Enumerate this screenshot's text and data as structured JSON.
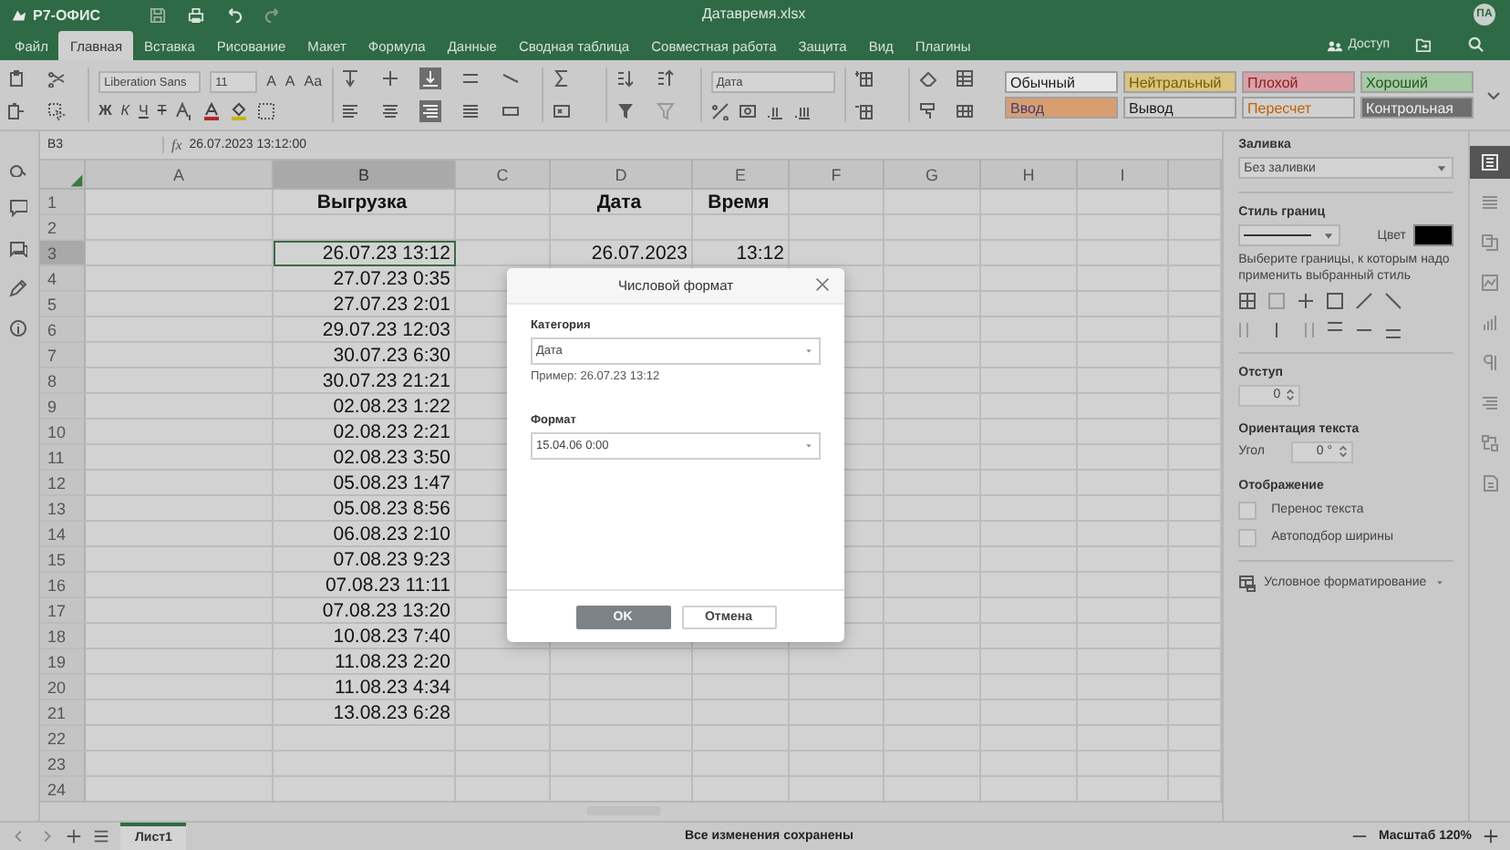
{
  "app": {
    "logo": "Р7-ОФИС",
    "file_name": "Датавремя.xlsx",
    "avatar": "ПА"
  },
  "menu_tabs": [
    {
      "label": "Файл",
      "selected": false
    },
    {
      "label": "Главная",
      "selected": true
    },
    {
      "label": "Вставка",
      "selected": false
    },
    {
      "label": "Рисование",
      "selected": false
    },
    {
      "label": "Макет",
      "selected": false
    },
    {
      "label": "Формула",
      "selected": false
    },
    {
      "label": "Данные",
      "selected": false
    },
    {
      "label": "Сводная таблица",
      "selected": false
    },
    {
      "label": "Совместная работа",
      "selected": false
    },
    {
      "label": "Защита",
      "selected": false
    },
    {
      "label": "Вид",
      "selected": false
    },
    {
      "label": "Плагины",
      "selected": false
    }
  ],
  "share": {
    "label": "Доступ"
  },
  "ribbon": {
    "font_name": "Liberation Sans",
    "font_size": "11",
    "font_buttons": [
      "A",
      "A",
      "Aa"
    ],
    "format_buttons": [
      "Ж",
      "К",
      "Ч",
      "Т"
    ],
    "number_format": "Дата",
    "cell_styles": [
      {
        "label": "Обычный",
        "color": "#e8e8e8"
      },
      {
        "label": "Нейтральный",
        "color": "#d9c480"
      },
      {
        "label": "Плохой",
        "color": "#d9a0a8"
      },
      {
        "label": "Хороший",
        "color": "#a6c9a6"
      },
      {
        "label": "Ввод",
        "color": "#d99e70"
      },
      {
        "label": "Вывод",
        "color": "#d0d0d0"
      },
      {
        "label": "Пересчет",
        "color": "#d0d0d0"
      },
      {
        "label": "Контрольная",
        "color": "#6e6e6e"
      }
    ]
  },
  "formula_bar": {
    "cell_ref": "B3",
    "fx": "fx",
    "formula": "26.07.2023 13:12:00"
  },
  "sheet": {
    "columns": [
      {
        "label": "A",
        "selected": false
      },
      {
        "label": "B",
        "selected": true
      },
      {
        "label": "C",
        "selected": false
      },
      {
        "label": "D",
        "selected": false
      },
      {
        "label": "E",
        "selected": false
      },
      {
        "label": "F",
        "selected": false
      },
      {
        "label": "G",
        "selected": false
      },
      {
        "label": "H",
        "selected": false
      },
      {
        "label": "I",
        "selected": false
      }
    ],
    "rows": [
      {
        "number": "1",
        "kind": "header",
        "selected": false,
        "column_b": "Выгрузка",
        "column_d": "Дата",
        "column_e": "Время"
      },
      {
        "number": "2",
        "kind": "data",
        "selected": false
      },
      {
        "number": "3",
        "kind": "data",
        "selected": true,
        "column_b": "26.07.23 13:12",
        "column_d": "26.07.2023",
        "column_e": "13:12"
      },
      {
        "number": "4",
        "kind": "data",
        "selected": false,
        "column_b": "27.07.23 0:35"
      },
      {
        "number": "5",
        "kind": "data",
        "selected": false,
        "column_b": "27.07.23 2:01"
      },
      {
        "number": "6",
        "kind": "data",
        "selected": false,
        "column_b": "29.07.23 12:03"
      },
      {
        "number": "7",
        "kind": "data",
        "selected": false,
        "column_b": "30.07.23 6:30"
      },
      {
        "number": "8",
        "kind": "data",
        "selected": false,
        "column_b": "30.07.23 21:21"
      },
      {
        "number": "9",
        "kind": "data",
        "selected": false,
        "column_b": "02.08.23 1:22"
      },
      {
        "number": "10",
        "kind": "data",
        "selected": false,
        "column_b": "02.08.23 2:21"
      },
      {
        "number": "11",
        "kind": "data",
        "selected": false,
        "column_b": "02.08.23 3:50"
      },
      {
        "number": "12",
        "kind": "data",
        "selected": false,
        "column_b": "05.08.23 1:47"
      },
      {
        "number": "13",
        "kind": "data",
        "selected": false,
        "column_b": "05.08.23 8:56"
      },
      {
        "number": "14",
        "kind": "data",
        "selected": false,
        "column_b": "06.08.23 2:10"
      },
      {
        "number": "15",
        "kind": "data",
        "selected": false,
        "column_b": "07.08.23 9:23"
      },
      {
        "number": "16",
        "kind": "data",
        "selected": false,
        "column_b": "07.08.23 11:11"
      },
      {
        "number": "17",
        "kind": "data",
        "selected": false,
        "column_b": "07.08.23 13:20"
      },
      {
        "number": "18",
        "kind": "data",
        "selected": false,
        "column_b": "10.08.23 7:40"
      },
      {
        "number": "19",
        "kind": "data",
        "selected": false,
        "column_b": "11.08.23 2:20"
      },
      {
        "number": "20",
        "kind": "data",
        "selected": false,
        "column_b": "11.08.23 4:34"
      },
      {
        "number": "21",
        "kind": "data",
        "selected": false,
        "column_b": "13.08.23 6:28"
      },
      {
        "number": "22",
        "kind": "data",
        "selected": false
      },
      {
        "number": "23",
        "kind": "data",
        "selected": false
      },
      {
        "number": "24",
        "kind": "data",
        "selected": false
      }
    ]
  },
  "format_panel": {
    "fill": {
      "title": "Заливка",
      "value": "Без заливки"
    },
    "border": {
      "title": "Стиль границ",
      "color_label": "Цвет",
      "hint": "Выберите границы, к которым надо применить выбранный стиль"
    },
    "indent": {
      "title": "Отступ",
      "value": "0"
    },
    "orientation": {
      "title": "Ориентация текста",
      "angle_label": "Угол",
      "angle": "0 °"
    },
    "display": {
      "title": "Отображение",
      "options": [
        {
          "label": "Перенос текста",
          "checked": false
        },
        {
          "label": "Автоподбор ширины",
          "checked": false
        }
      ]
    },
    "conditional": "Условное форматирование"
  },
  "side_tabs": [
    {
      "selected": true
    },
    {
      "selected": false
    },
    {
      "selected": false
    },
    {
      "selected": false
    },
    {
      "selected": false
    },
    {
      "selected": false
    },
    {
      "selected": false
    },
    {
      "selected": false
    },
    {
      "selected": false
    }
  ],
  "dialog": {
    "title": "Числовой формат",
    "category": {
      "label": "Категория",
      "value": "Дата"
    },
    "example": "Пример: 26.07.23 13:12",
    "format": {
      "label": "Формат",
      "value": "15.04.06 0:00"
    },
    "buttons": [
      {
        "label": "OK",
        "kind": "primary"
      },
      {
        "label": "Отмена",
        "kind": "secondary"
      }
    ]
  },
  "status_bar": {
    "sheet_tabs": [
      {
        "label": "Лист1",
        "selected": true
      }
    ],
    "status": "Все изменения сохранены",
    "zoom": "Масштаб 120%"
  }
}
